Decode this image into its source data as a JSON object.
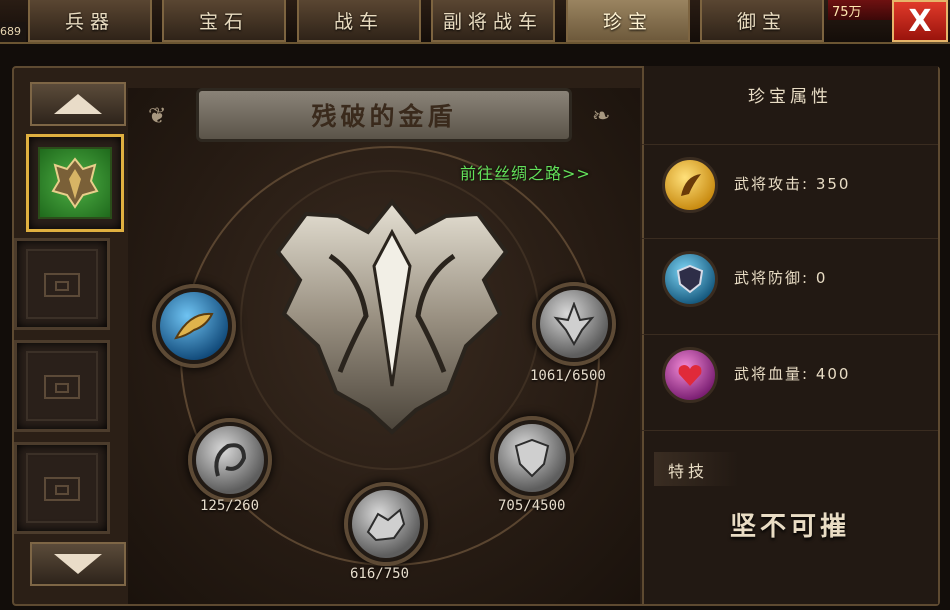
{
  "tabs": [
    {
      "label": "兵器",
      "active": false
    },
    {
      "label": "宝石",
      "active": false
    },
    {
      "label": "战车",
      "active": false
    },
    {
      "label": "副将战车",
      "active": false
    },
    {
      "label": "珍宝",
      "active": true
    },
    {
      "label": "御宝",
      "active": false
    }
  ],
  "header": {
    "corner_badge": "689",
    "wealth": "75万",
    "close_label": "X"
  },
  "treasure": {
    "name": "残破的金盾",
    "goto_link": "前往丝绸之路>>",
    "fragments": [
      {
        "icon": "golden-wing-fragment-icon",
        "count": ""
      },
      {
        "icon": "silver-spike-fragment-icon",
        "count": "1061/6500"
      },
      {
        "icon": "silver-swirl-fragment-icon",
        "count": "125/260"
      },
      {
        "icon": "silver-crest-fragment-icon",
        "count": "705/4500"
      },
      {
        "icon": "silver-beast-fragment-icon",
        "count": "616/750"
      }
    ]
  },
  "slots": [
    {
      "state": "selected",
      "icon": "golden-shield-icon"
    },
    {
      "state": "locked",
      "icon": "chest-icon"
    },
    {
      "state": "locked",
      "icon": "chest-icon"
    },
    {
      "state": "locked",
      "icon": "chest-icon"
    }
  ],
  "properties": {
    "title": "珍宝属性",
    "rows": [
      {
        "icon": "attack-icon",
        "label": "武将攻击: 350"
      },
      {
        "icon": "defense-icon",
        "label": "武将防御: 0"
      },
      {
        "icon": "health-icon",
        "label": "武将血量: 400"
      }
    ],
    "skill_tag": "特技",
    "skill_name": "坚不可摧"
  },
  "colors": {
    "accent_gold": "#e0b040",
    "link_green": "#63e05a",
    "close_red": "#d42a1e"
  }
}
